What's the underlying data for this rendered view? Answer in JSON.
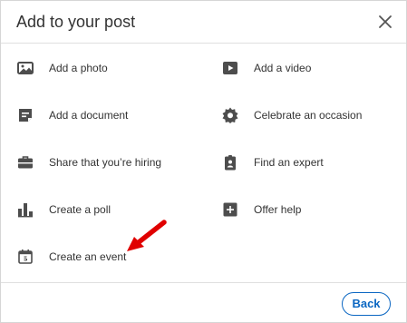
{
  "header": {
    "title": "Add to your post",
    "close_icon": "close-icon"
  },
  "options": [
    {
      "label": "Add a photo",
      "icon": "photo-icon"
    },
    {
      "label": "Add a video",
      "icon": "video-icon"
    },
    {
      "label": "Add a document",
      "icon": "document-icon"
    },
    {
      "label": "Celebrate an occasion",
      "icon": "celebrate-icon"
    },
    {
      "label": "Share that you’re hiring",
      "icon": "briefcase-icon"
    },
    {
      "label": "Find an expert",
      "icon": "expert-badge-icon"
    },
    {
      "label": "Create a poll",
      "icon": "poll-icon"
    },
    {
      "label": "Offer help",
      "icon": "offer-help-icon"
    },
    {
      "label": "Create an event",
      "icon": "calendar-icon"
    }
  ],
  "footer": {
    "back_label": "Back"
  },
  "colors": {
    "icon": "#4d4d4d",
    "accent": "#0a66c2",
    "annotation_arrow": "#e00000"
  }
}
